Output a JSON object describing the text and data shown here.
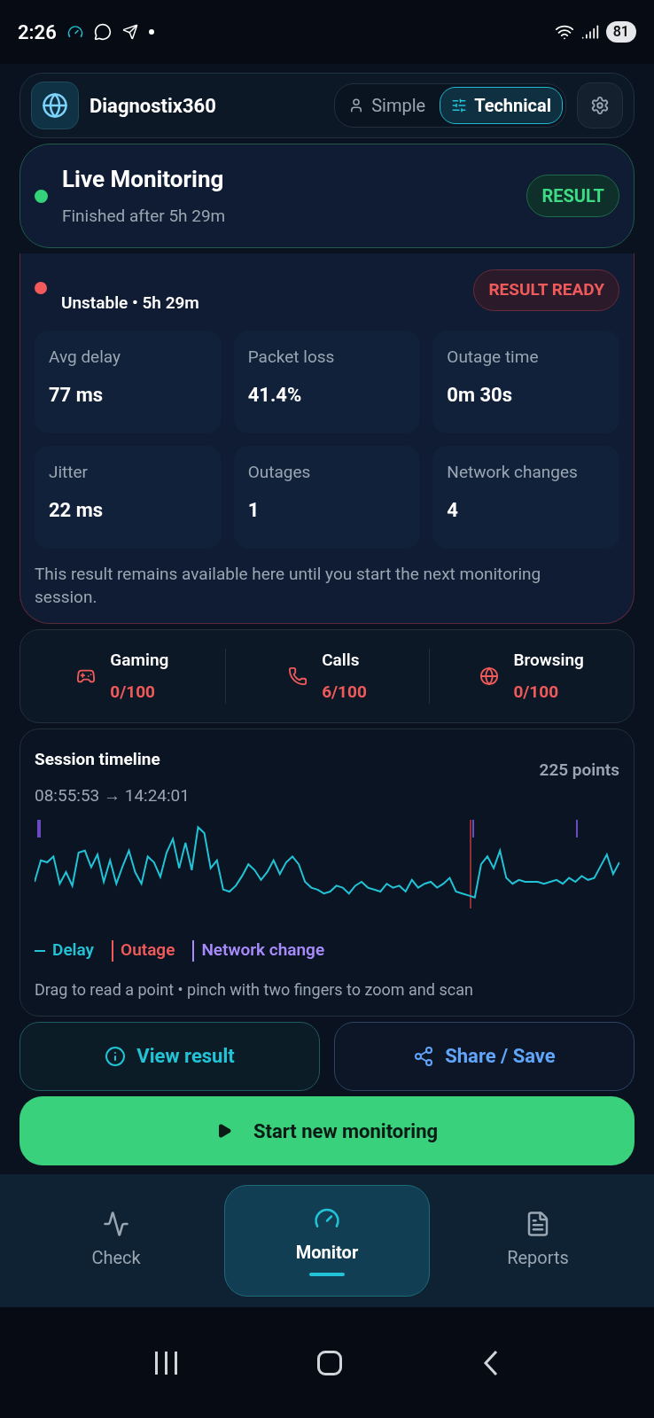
{
  "status_bar": {
    "time": "2:26",
    "battery": "81"
  },
  "header": {
    "app_name": "Diagnostix360",
    "modes": [
      {
        "label": "Simple",
        "kind": "person",
        "selected": false
      },
      {
        "label": "Technical",
        "kind": "sliders",
        "selected": true
      }
    ]
  },
  "live_card": {
    "title": "Live Monitoring",
    "subtitle": "Finished after 5h 29m",
    "badge": "RESULT"
  },
  "result_card": {
    "subtitle": "Unstable • 5h 29m",
    "badge": "RESULT READY",
    "stats": [
      {
        "label": "Avg delay",
        "value": "77 ms"
      },
      {
        "label": "Packet loss",
        "value": "41.4%"
      },
      {
        "label": "Outage time",
        "value": "0m 30s"
      },
      {
        "label": "Jitter",
        "value": "22 ms"
      },
      {
        "label": "Outages",
        "value": "1"
      },
      {
        "label": "Network changes",
        "value": "4"
      }
    ],
    "note": "This result remains available here until you start the next monitoring session."
  },
  "scores": [
    {
      "kind": "gaming",
      "label": "Gaming",
      "value": "0/100"
    },
    {
      "kind": "calls",
      "label": "Calls",
      "value": "6/100"
    },
    {
      "kind": "browsing",
      "label": "Browsing",
      "value": "0/100"
    }
  ],
  "timeline": {
    "title": "Session timeline",
    "range": "08:55:53 → 14:24:01",
    "points": "225 points",
    "legend": [
      {
        "kind": "delay",
        "label": "Delay"
      },
      {
        "kind": "outage",
        "label": "Outage"
      },
      {
        "kind": "network",
        "label": "Network change"
      }
    ],
    "hint": "Drag to read a point • pinch with two fingers to zoom and scan"
  },
  "actions": [
    {
      "kind": "info",
      "label": "View result"
    },
    {
      "kind": "share",
      "label": "Share / Save"
    }
  ],
  "primary_action": "Start new monitoring",
  "nav": [
    {
      "kind": "check",
      "label": "Check",
      "selected": false
    },
    {
      "kind": "monitor",
      "label": "Monitor",
      "selected": true
    },
    {
      "kind": "reports",
      "label": "Reports",
      "selected": false
    }
  ]
}
